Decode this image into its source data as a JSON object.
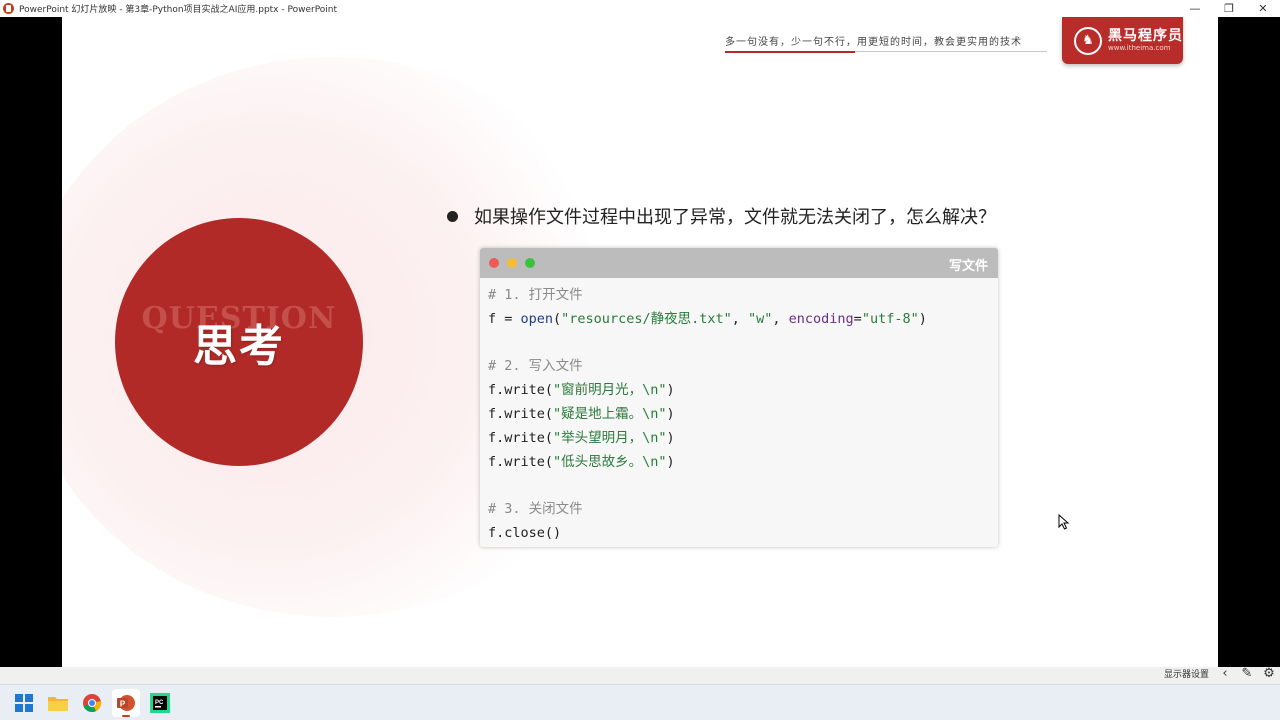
{
  "window": {
    "title": "PowerPoint 幻灯片放映  -  第3章-Python项目实战之AI应用.pptx  -  PowerPoint",
    "controls": {
      "minimize": "—",
      "restore": "❐",
      "close": "✕"
    }
  },
  "slide": {
    "slogan": "多一句没有，少一句不行，用更短的时间，教会更实用的技术",
    "logo": {
      "name": "黑马程序员",
      "url": "www.itheima.com"
    },
    "badge": {
      "watermark": "QUESTION",
      "label": "思考"
    },
    "question": "如果操作文件过程中出现了异常，文件就无法关闭了，怎么解决？",
    "code_window": {
      "title": "写文件",
      "lines": [
        "# 1. 打开文件",
        "f = open(\"resources/静夜思.txt\", \"w\", encoding=\"utf-8\")",
        "",
        "# 2. 写入文件",
        "f.write(\"窗前明月光，\\n\")",
        "f.write(\"疑是地上霜。\\n\")",
        "f.write(\"举头望明月，\\n\")",
        "f.write(\"低头思故乡。\\n\")",
        "",
        "# 3. 关闭文件",
        "f.close()"
      ]
    }
  },
  "slideshow_controls": {
    "presenter_view": "显示器设置",
    "icons": [
      "prev-icon",
      "pen-icon",
      "settings-icon"
    ]
  },
  "taskbar": {
    "apps": [
      "windows-start-icon",
      "file-explorer-icon",
      "chrome-icon",
      "powerpoint-icon",
      "pycharm-icon"
    ]
  },
  "colors": {
    "brand_red": "#b22a28",
    "code_bg": "#f7f7f7",
    "code_header": "#bcbcbc"
  }
}
